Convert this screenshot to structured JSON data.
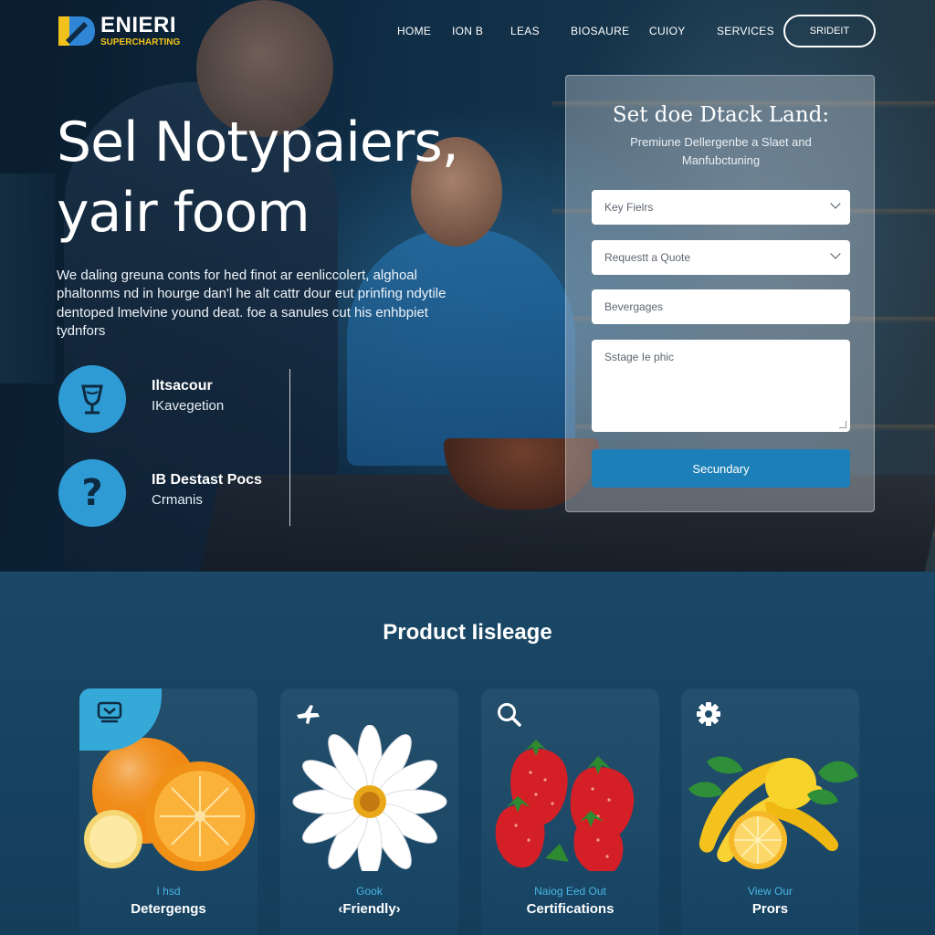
{
  "brand": {
    "name": "ENIERI",
    "tagline": "SUPERCHARTING"
  },
  "nav": {
    "items": [
      "HOME",
      "ION B",
      "LEAS",
      "BIOSAURE",
      "CUIOY",
      "SERVICES"
    ],
    "cta": "SRIDEIT"
  },
  "hero": {
    "title_line1": "Sel Notypaiers,",
    "title_line2": "yair foom",
    "copy": "We daling greuna conts for hed finot ar eenliccolert, alghoal phaltonms nd in hourge dan'l he alt cattr dour eut prinfing ndytile dentoped lmelvine yound deat. foe a sanules cut his enhbpiet tydnfors",
    "features": [
      {
        "icon": "goblet-icon",
        "title": "Iltsacour",
        "sub": "IKavegetion"
      },
      {
        "icon": "question-icon",
        "title": "IB Destast Pocs",
        "sub": "Crmanis"
      }
    ]
  },
  "form": {
    "title": "Set doe Dtack Land:",
    "subtitle": "Premiune Dellergenbe a Slaet and Manfubctuning",
    "field1": "Key Fielrs",
    "field2": "Requestt a Quote",
    "field3": "Bevergages",
    "textarea": "Sstage Ie phic",
    "submit": "Secundary"
  },
  "products": {
    "title": "Product Iisleage",
    "cards": [
      {
        "icon": "badge-icon",
        "kicker": "I hsd",
        "name": "Detergengs",
        "art": "orange"
      },
      {
        "icon": "plane-icon",
        "kicker": "Gook",
        "name": "‹Friendly›",
        "art": "flower"
      },
      {
        "icon": "search-icon",
        "kicker": "Naiog Eed Out",
        "name": "Certifications",
        "art": "strawberry"
      },
      {
        "icon": "gear-icon",
        "kicker": "View Our",
        "name": "Prors",
        "art": "banana"
      }
    ]
  },
  "colors": {
    "accent": "#2f9bd5",
    "button": "#1c7fb8",
    "logo_yellow": "#f2c21a",
    "section_bg": "#143d5a"
  }
}
